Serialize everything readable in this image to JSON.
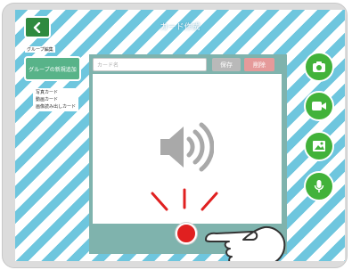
{
  "header": {
    "title": "カード作成",
    "back_icon": "chevron-left-icon"
  },
  "sidebar": {
    "title": "グループ編集",
    "group_button": "グループの新規追加",
    "items": [
      {
        "label": "写真カード"
      },
      {
        "label": "動画カード"
      },
      {
        "label": "画像読み出しカード"
      }
    ]
  },
  "editor": {
    "name_placeholder": "カード名",
    "save_label": "保存",
    "delete_label": "削除",
    "preview_icon": "speaker-icon"
  },
  "tools": [
    {
      "icon": "camera-icon"
    },
    {
      "icon": "video-camera-icon"
    },
    {
      "icon": "gallery-icon"
    },
    {
      "icon": "microphone-icon"
    }
  ],
  "colors": {
    "stripe": "#6ec6de",
    "accent_green": "#42b23a",
    "back_button": "#2f8a3f",
    "record": "#e02020",
    "delete": "#e59a9a",
    "save": "#b9b9b9"
  }
}
